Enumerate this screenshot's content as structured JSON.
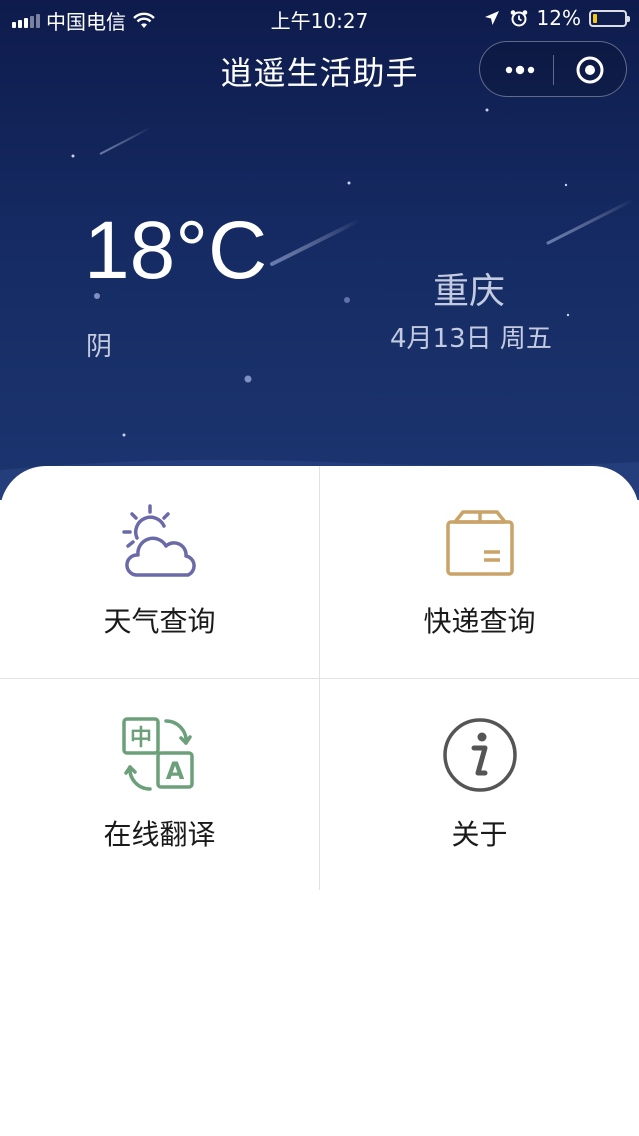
{
  "status_bar": {
    "carrier": "中国电信",
    "time": "上午10:27",
    "battery_percent": "12%",
    "signal_icon": "signal-icon",
    "wifi_icon": "wifi-icon",
    "location_icon": "location-arrow-icon",
    "alarm_icon": "alarm-clock-icon",
    "battery_level": 0.12,
    "battery_fill_color": "#f5c518"
  },
  "nav": {
    "title": "逍遥生活助手",
    "more_icon": "more-dots-icon",
    "close_icon": "close-target-icon"
  },
  "weather": {
    "temperature": "18°C",
    "condition": "阴",
    "city": "重庆",
    "date": "4月13日 周五"
  },
  "menu": {
    "items": [
      {
        "label": "天气查询",
        "icon": "weather-sun-cloud-icon",
        "color": "#6a6aa8"
      },
      {
        "label": "快递查询",
        "icon": "package-box-icon",
        "color": "#c9a368"
      },
      {
        "label": "在线翻译",
        "icon": "translate-icon",
        "color": "#6ba07a"
      },
      {
        "label": "关于",
        "icon": "info-icon",
        "color": "#555555"
      }
    ]
  },
  "colors": {
    "hero_top": "#0e1b4c",
    "hero_bottom": "#1c3570"
  }
}
